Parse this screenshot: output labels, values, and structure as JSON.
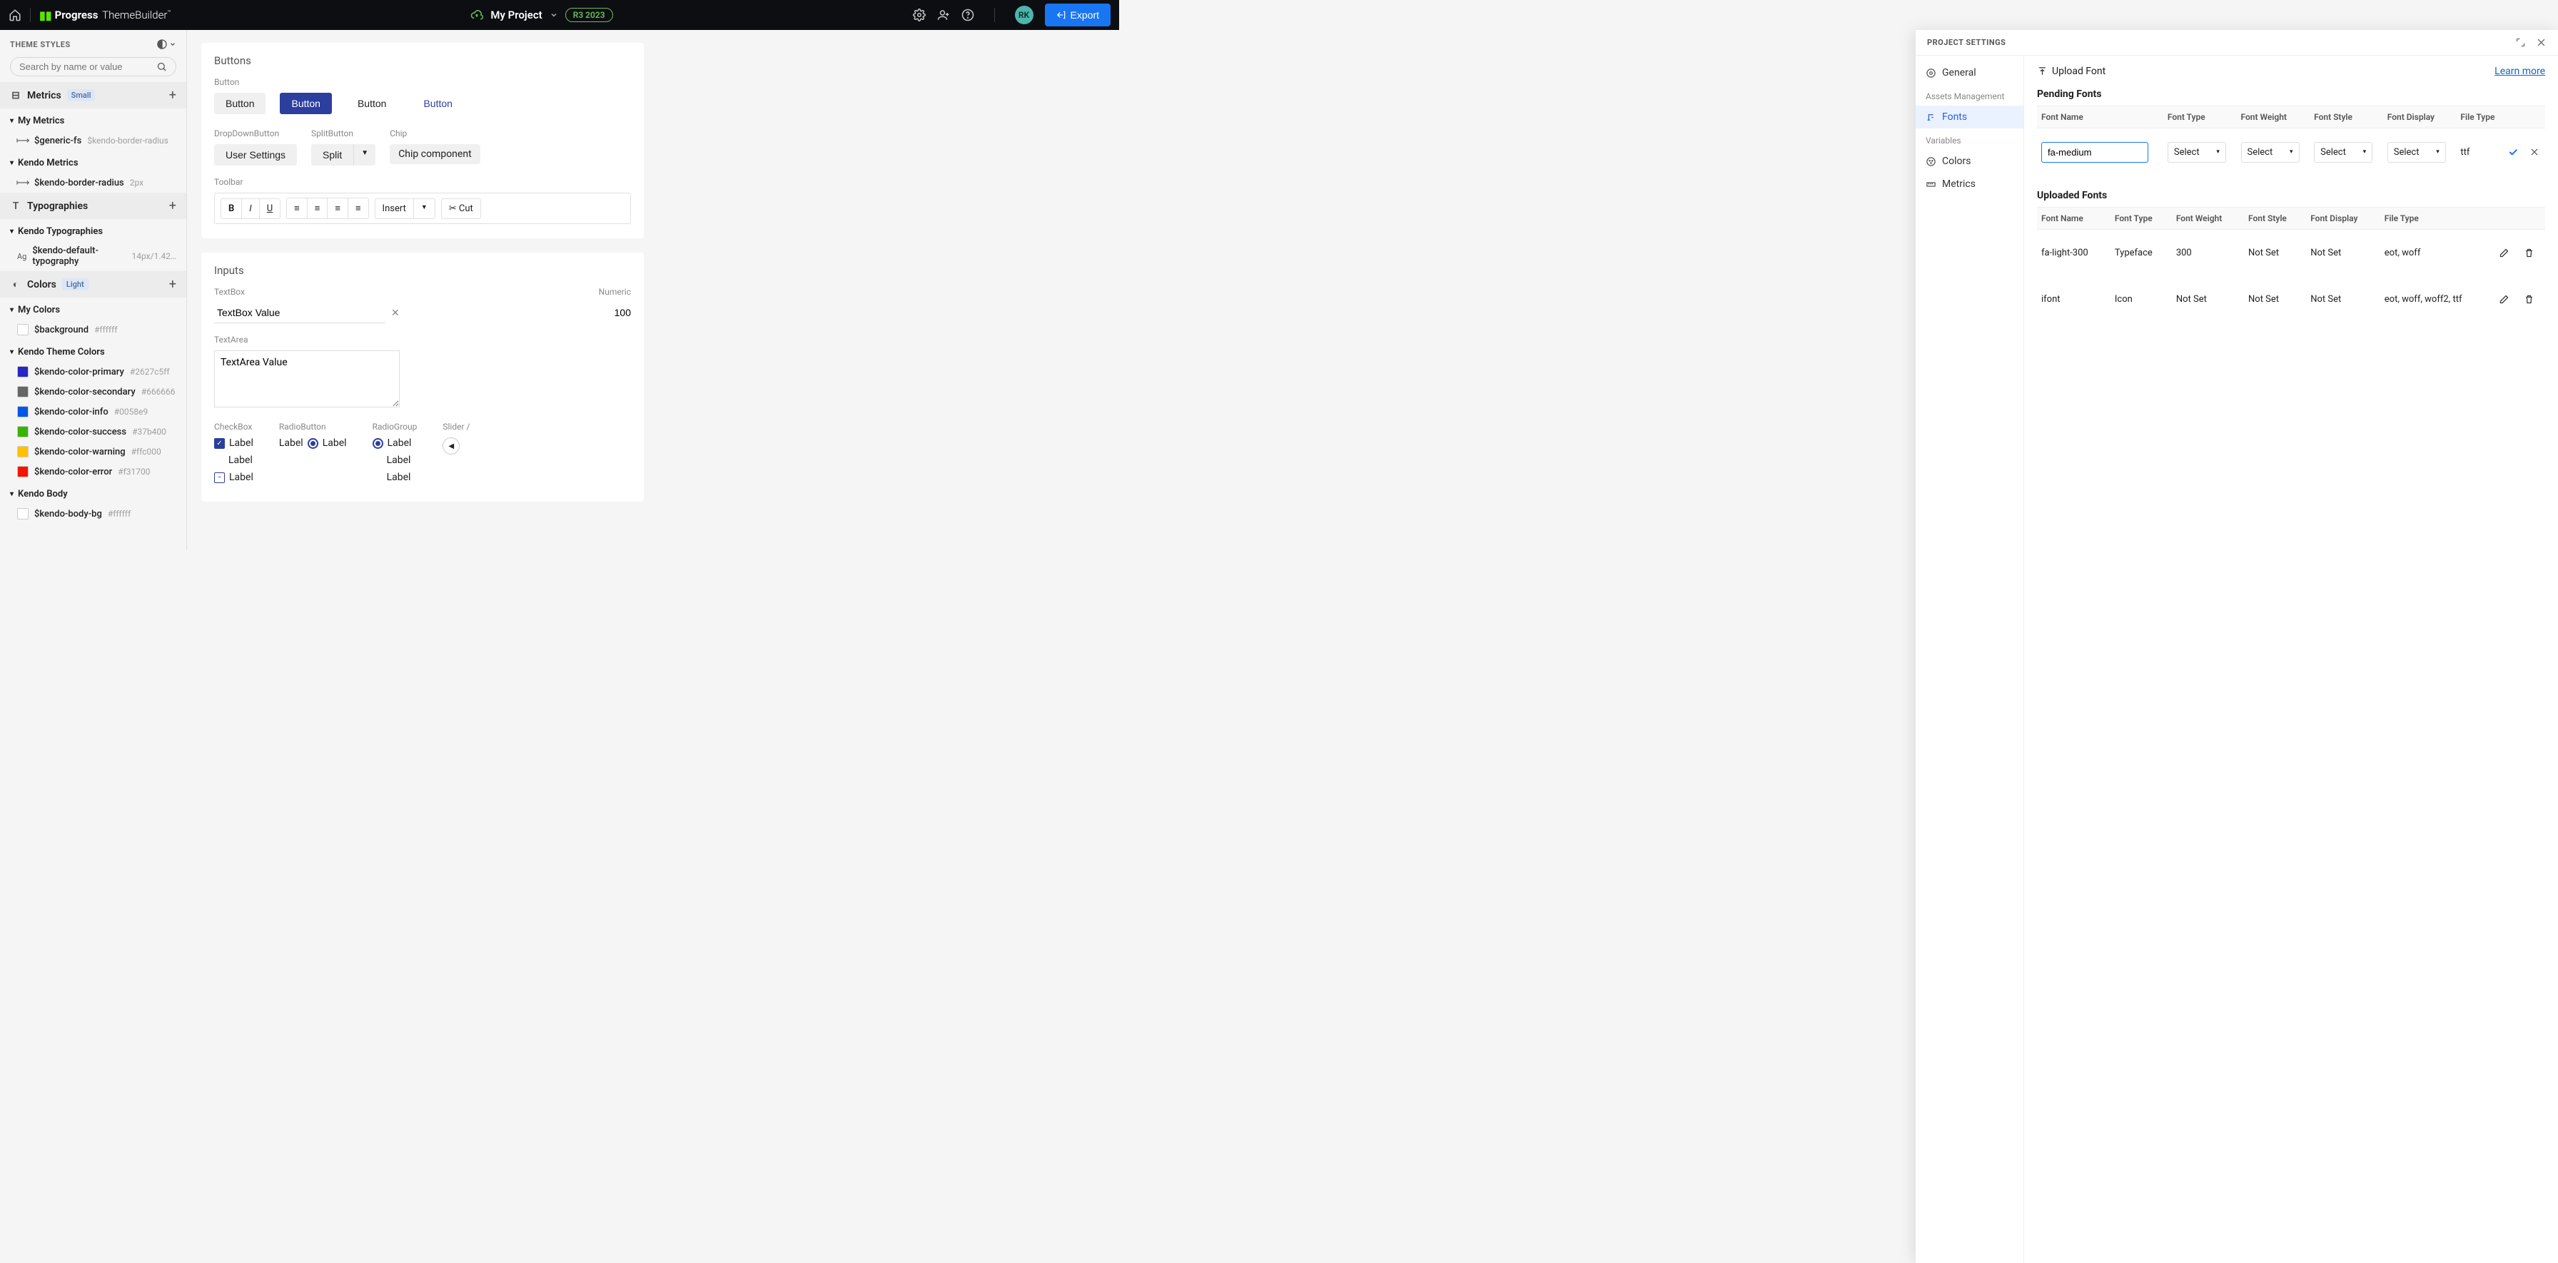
{
  "topbar": {
    "project_name": "My Project",
    "release_badge": "R3 2023",
    "avatar": "RK",
    "export_label": "Export"
  },
  "sidebar": {
    "title": "THEME STYLES",
    "search_placeholder": "Search by name or value",
    "metrics": {
      "label": "Metrics",
      "tag": "Small",
      "groups": [
        {
          "name": "My Metrics",
          "items": [
            {
              "name": "$generic-fs",
              "meta": "$kendo-border-radius"
            }
          ]
        },
        {
          "name": "Kendo Metrics",
          "items": [
            {
              "name": "$kendo-border-radius",
              "meta": "2px"
            }
          ]
        }
      ]
    },
    "typographies": {
      "label": "Typographies",
      "groups": [
        {
          "name": "Kendo Typographies",
          "items": [
            {
              "name": "$kendo-default-typography",
              "meta": "14px/1.42…"
            }
          ]
        }
      ]
    },
    "colors": {
      "label": "Colors",
      "tag": "Light",
      "groups": [
        {
          "name": "My Colors",
          "items": [
            {
              "name": "$background",
              "meta": "#ffffff",
              "swatch": "#ffffff"
            }
          ]
        },
        {
          "name": "Kendo Theme Colors",
          "items": [
            {
              "name": "$kendo-color-primary",
              "meta": "#2627c5ff",
              "swatch": "#2627c5"
            },
            {
              "name": "$kendo-color-secondary",
              "meta": "#666666",
              "swatch": "#666666"
            },
            {
              "name": "$kendo-color-info",
              "meta": "#0058e9",
              "swatch": "#0058e9"
            },
            {
              "name": "$kendo-color-success",
              "meta": "#37b400",
              "swatch": "#37b400"
            },
            {
              "name": "$kendo-color-warning",
              "meta": "#ffc000",
              "swatch": "#ffc000"
            },
            {
              "name": "$kendo-color-error",
              "meta": "#f31700",
              "swatch": "#f31700"
            }
          ]
        },
        {
          "name": "Kendo Body",
          "items": [
            {
              "name": "$kendo-body-bg",
              "meta": "#ffffff",
              "swatch": "#ffffff"
            }
          ]
        }
      ]
    }
  },
  "canvas": {
    "buttons": {
      "title": "Buttons",
      "button_label": "Button",
      "btns": [
        "Button",
        "Button",
        "Button",
        "Button"
      ],
      "dd_label": "DropDownButton",
      "dd_btn": "User Settings",
      "split_label": "SplitButton",
      "split_btn": "Split",
      "chip_label": "Chip",
      "chip": "Chip component",
      "toolbar_label": "Toolbar",
      "insert": "Insert",
      "cut": "Cut"
    },
    "inputs": {
      "title": "Inputs",
      "textbox_label": "TextBox",
      "textbox_value": "TextBox Value",
      "numeric_label": "Numeric",
      "numeric_value": "100",
      "textarea_label": "TextArea",
      "textarea_value": "TextArea Value",
      "checkbox_label": "CheckBox",
      "radio_label_1": "RadioButton",
      "radio_label_2": "RadioGroup",
      "slider_label": "Slider /",
      "item_label": "Label"
    }
  },
  "panel": {
    "title": "PROJECT SETTINGS",
    "nav": {
      "general": "General",
      "assets_hdr": "Assets Management",
      "fonts": "Fonts",
      "variables_hdr": "Variables",
      "colors": "Colors",
      "metrics": "Metrics"
    },
    "upload": "Upload Font",
    "learn": "Learn more",
    "pending_title": "Pending Fonts",
    "uploaded_title": "Uploaded Fonts",
    "cols": {
      "name": "Font Name",
      "type": "Font Type",
      "weight": "Font Weight",
      "style": "Font Style",
      "display": "Font Display",
      "file": "File Type"
    },
    "pending": {
      "name_input": "fa-medium",
      "select_ph": "Select",
      "file": "ttf"
    },
    "uploaded": [
      {
        "name": "fa-light-300",
        "type": "Typeface",
        "weight": "300",
        "style": "Not Set",
        "display": "Not Set",
        "file": "eot, woff"
      },
      {
        "name": "ifont",
        "type": "Icon",
        "weight": "Not Set",
        "style": "Not Set",
        "display": "Not Set",
        "file": "eot, woff, woff2, ttf"
      }
    ]
  }
}
